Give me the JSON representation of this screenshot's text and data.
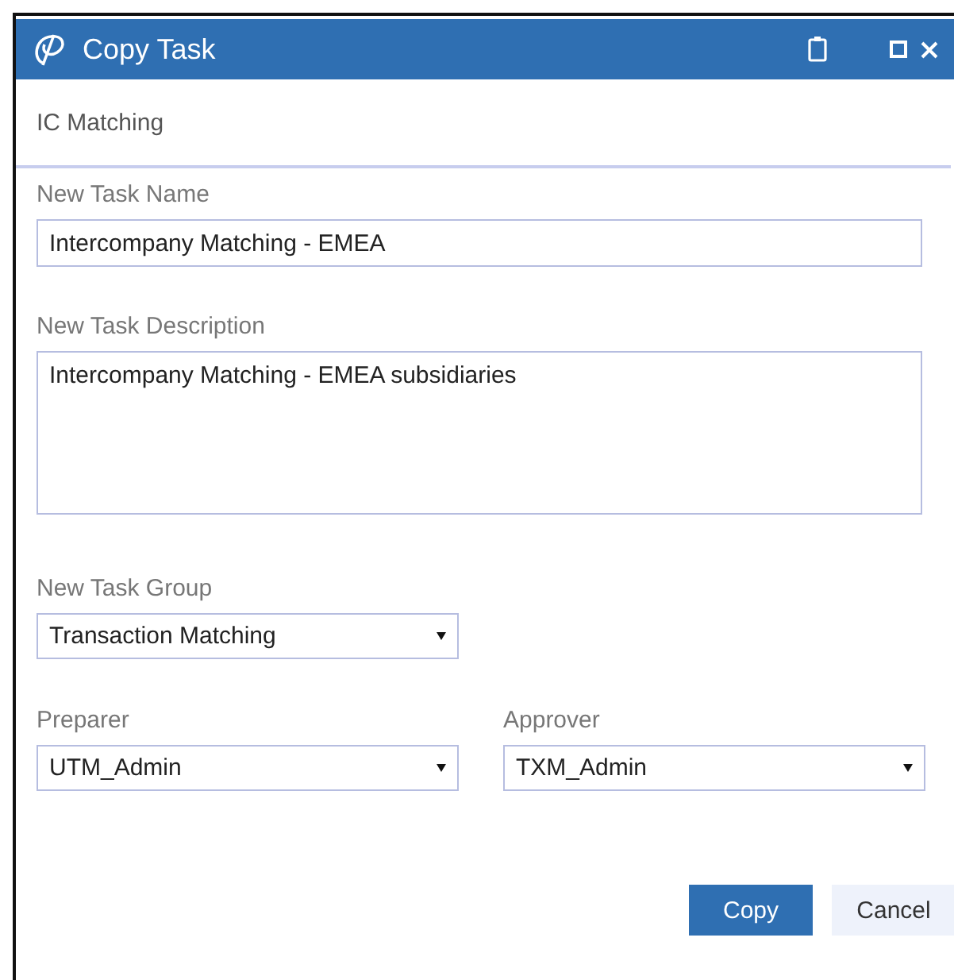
{
  "window": {
    "title": "Copy Task"
  },
  "subtitle": "IC Matching",
  "task_name": {
    "label": "New Task Name",
    "value": "Intercompany Matching - EMEA"
  },
  "task_description": {
    "label": "New Task Description",
    "value": "Intercompany Matching - EMEA subsidiaries"
  },
  "task_group": {
    "label": "New Task Group",
    "value": "Transaction Matching"
  },
  "preparer": {
    "label": "Preparer",
    "value": "UTM_Admin"
  },
  "approver": {
    "label": "Approver",
    "value": "TXM_Admin"
  },
  "buttons": [
    {
      "label": "Copy",
      "kind": "primary"
    },
    {
      "label": "Cancel",
      "kind": "secondary"
    }
  ]
}
